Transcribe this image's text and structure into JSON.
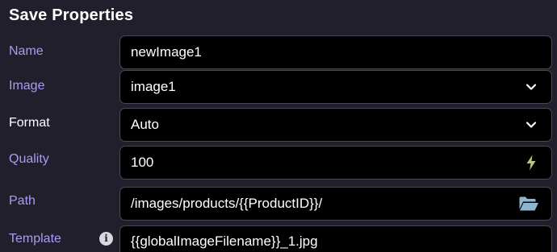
{
  "panel": {
    "title": "Save Properties"
  },
  "fields": {
    "name": {
      "label": "Name",
      "value": "newImage1"
    },
    "image": {
      "label": "Image",
      "value": "image1",
      "icon": "chevron-down-icon"
    },
    "format": {
      "label": "Format",
      "value": "Auto",
      "icon": "chevron-down-icon"
    },
    "quality": {
      "label": "Quality",
      "value": "100",
      "icon": "lightning-icon"
    },
    "path": {
      "label": "Path",
      "value": "/images/products/{{ProductID}}/",
      "icon": "folder-open-icon"
    },
    "template": {
      "label": "Template",
      "value": "{{globalImageFilename}}_1.jpg",
      "icon": "info-icon"
    }
  },
  "colors": {
    "background": "#211f2c",
    "label_accent": "#a89df0",
    "field_background": "#000000",
    "field_border": "#4a4857",
    "lightning": "#b9c77e",
    "folder": "#8fb6cf"
  }
}
